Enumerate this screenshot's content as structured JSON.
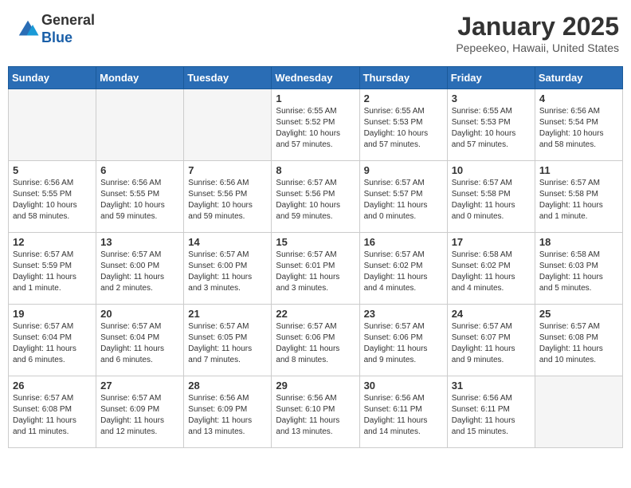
{
  "header": {
    "logo_general": "General",
    "logo_blue": "Blue",
    "month_title": "January 2025",
    "location": "Pepeekeo, Hawaii, United States"
  },
  "weekdays": [
    "Sunday",
    "Monday",
    "Tuesday",
    "Wednesday",
    "Thursday",
    "Friday",
    "Saturday"
  ],
  "weeks": [
    [
      {
        "day": "",
        "info": ""
      },
      {
        "day": "",
        "info": ""
      },
      {
        "day": "",
        "info": ""
      },
      {
        "day": "1",
        "info": "Sunrise: 6:55 AM\nSunset: 5:52 PM\nDaylight: 10 hours and 57 minutes."
      },
      {
        "day": "2",
        "info": "Sunrise: 6:55 AM\nSunset: 5:53 PM\nDaylight: 10 hours and 57 minutes."
      },
      {
        "day": "3",
        "info": "Sunrise: 6:55 AM\nSunset: 5:53 PM\nDaylight: 10 hours and 57 minutes."
      },
      {
        "day": "4",
        "info": "Sunrise: 6:56 AM\nSunset: 5:54 PM\nDaylight: 10 hours and 58 minutes."
      }
    ],
    [
      {
        "day": "5",
        "info": "Sunrise: 6:56 AM\nSunset: 5:55 PM\nDaylight: 10 hours and 58 minutes."
      },
      {
        "day": "6",
        "info": "Sunrise: 6:56 AM\nSunset: 5:55 PM\nDaylight: 10 hours and 59 minutes."
      },
      {
        "day": "7",
        "info": "Sunrise: 6:56 AM\nSunset: 5:56 PM\nDaylight: 10 hours and 59 minutes."
      },
      {
        "day": "8",
        "info": "Sunrise: 6:57 AM\nSunset: 5:56 PM\nDaylight: 10 hours and 59 minutes."
      },
      {
        "day": "9",
        "info": "Sunrise: 6:57 AM\nSunset: 5:57 PM\nDaylight: 11 hours and 0 minutes."
      },
      {
        "day": "10",
        "info": "Sunrise: 6:57 AM\nSunset: 5:58 PM\nDaylight: 11 hours and 0 minutes."
      },
      {
        "day": "11",
        "info": "Sunrise: 6:57 AM\nSunset: 5:58 PM\nDaylight: 11 hours and 1 minute."
      }
    ],
    [
      {
        "day": "12",
        "info": "Sunrise: 6:57 AM\nSunset: 5:59 PM\nDaylight: 11 hours and 1 minute."
      },
      {
        "day": "13",
        "info": "Sunrise: 6:57 AM\nSunset: 6:00 PM\nDaylight: 11 hours and 2 minutes."
      },
      {
        "day": "14",
        "info": "Sunrise: 6:57 AM\nSunset: 6:00 PM\nDaylight: 11 hours and 3 minutes."
      },
      {
        "day": "15",
        "info": "Sunrise: 6:57 AM\nSunset: 6:01 PM\nDaylight: 11 hours and 3 minutes."
      },
      {
        "day": "16",
        "info": "Sunrise: 6:57 AM\nSunset: 6:02 PM\nDaylight: 11 hours and 4 minutes."
      },
      {
        "day": "17",
        "info": "Sunrise: 6:58 AM\nSunset: 6:02 PM\nDaylight: 11 hours and 4 minutes."
      },
      {
        "day": "18",
        "info": "Sunrise: 6:58 AM\nSunset: 6:03 PM\nDaylight: 11 hours and 5 minutes."
      }
    ],
    [
      {
        "day": "19",
        "info": "Sunrise: 6:57 AM\nSunset: 6:04 PM\nDaylight: 11 hours and 6 minutes."
      },
      {
        "day": "20",
        "info": "Sunrise: 6:57 AM\nSunset: 6:04 PM\nDaylight: 11 hours and 6 minutes."
      },
      {
        "day": "21",
        "info": "Sunrise: 6:57 AM\nSunset: 6:05 PM\nDaylight: 11 hours and 7 minutes."
      },
      {
        "day": "22",
        "info": "Sunrise: 6:57 AM\nSunset: 6:06 PM\nDaylight: 11 hours and 8 minutes."
      },
      {
        "day": "23",
        "info": "Sunrise: 6:57 AM\nSunset: 6:06 PM\nDaylight: 11 hours and 9 minutes."
      },
      {
        "day": "24",
        "info": "Sunrise: 6:57 AM\nSunset: 6:07 PM\nDaylight: 11 hours and 9 minutes."
      },
      {
        "day": "25",
        "info": "Sunrise: 6:57 AM\nSunset: 6:08 PM\nDaylight: 11 hours and 10 minutes."
      }
    ],
    [
      {
        "day": "26",
        "info": "Sunrise: 6:57 AM\nSunset: 6:08 PM\nDaylight: 11 hours and 11 minutes."
      },
      {
        "day": "27",
        "info": "Sunrise: 6:57 AM\nSunset: 6:09 PM\nDaylight: 11 hours and 12 minutes."
      },
      {
        "day": "28",
        "info": "Sunrise: 6:56 AM\nSunset: 6:09 PM\nDaylight: 11 hours and 13 minutes."
      },
      {
        "day": "29",
        "info": "Sunrise: 6:56 AM\nSunset: 6:10 PM\nDaylight: 11 hours and 13 minutes."
      },
      {
        "day": "30",
        "info": "Sunrise: 6:56 AM\nSunset: 6:11 PM\nDaylight: 11 hours and 14 minutes."
      },
      {
        "day": "31",
        "info": "Sunrise: 6:56 AM\nSunset: 6:11 PM\nDaylight: 11 hours and 15 minutes."
      },
      {
        "day": "",
        "info": ""
      }
    ]
  ]
}
